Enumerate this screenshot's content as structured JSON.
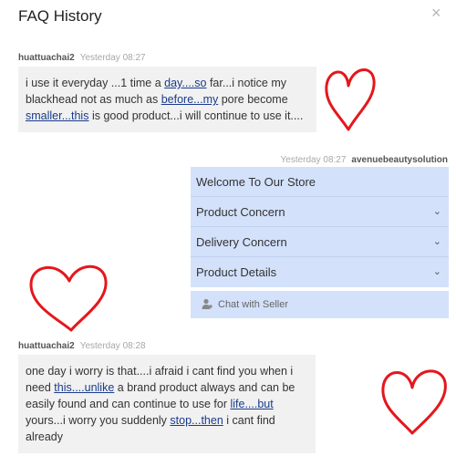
{
  "header": {
    "title": "FAQ History",
    "close_label": "×"
  },
  "messages": [
    {
      "author": "huattuachai2",
      "time": "Yesterday 08:27",
      "segments": [
        {
          "t": "i use it everyday ...1 time a "
        },
        {
          "t": "day....so",
          "link": true
        },
        {
          "t": " far...i notice my blackhead not as much as "
        },
        {
          "t": "before...my",
          "link": true
        },
        {
          "t": " pore become "
        },
        {
          "t": "smaller...this",
          "link": true
        },
        {
          "t": " is good product...i will continue to use it...."
        }
      ]
    },
    {
      "author": "huattuachai2",
      "time": "Yesterday 08:28",
      "segments": [
        {
          "t": "one day i worry is that....i afraid i cant find you when i need "
        },
        {
          "t": "this....unlike",
          "link": true
        },
        {
          "t": " a brand product always and can be easily found and can continue to use for "
        },
        {
          "t": "life....but",
          "link": true
        },
        {
          "t": " yours...i worry you suddenly "
        },
        {
          "t": "stop...then",
          "link": true
        },
        {
          "t": " i cant find already"
        }
      ]
    }
  ],
  "seller": {
    "name": "avenuebeautysolution",
    "time": "Yesterday 08:27",
    "menu": [
      {
        "label": "Welcome To Our Store",
        "chevron": false
      },
      {
        "label": "Product Concern",
        "chevron": true
      },
      {
        "label": "Delivery Concern",
        "chevron": true
      },
      {
        "label": "Product Details",
        "chevron": true
      }
    ],
    "chat_button": "Chat with Seller"
  },
  "colors": {
    "heart": "#e4171c",
    "menu_bg": "#d3e1fb",
    "bubble_bg": "#f1f1f1",
    "link": "#1a3b8c"
  }
}
